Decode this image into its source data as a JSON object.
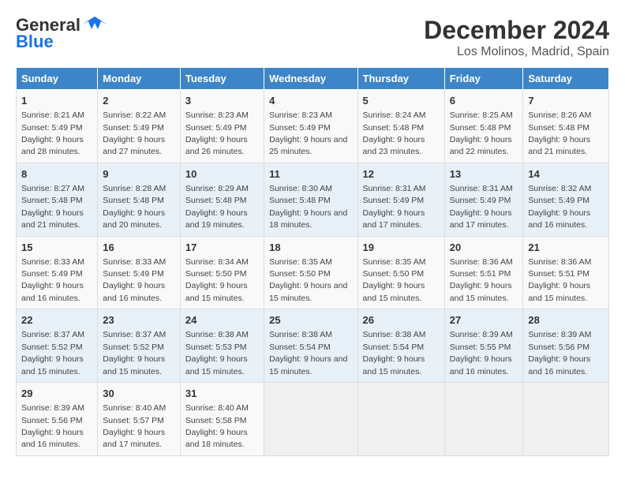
{
  "header": {
    "logo_line1": "General",
    "logo_line2": "Blue",
    "title": "December 2024",
    "subtitle": "Los Molinos, Madrid, Spain"
  },
  "days_of_week": [
    "Sunday",
    "Monday",
    "Tuesday",
    "Wednesday",
    "Thursday",
    "Friday",
    "Saturday"
  ],
  "weeks": [
    [
      {
        "day": "1",
        "sunrise": "8:21 AM",
        "sunset": "5:49 PM",
        "daylight": "9 hours and 28 minutes."
      },
      {
        "day": "2",
        "sunrise": "8:22 AM",
        "sunset": "5:49 PM",
        "daylight": "9 hours and 27 minutes."
      },
      {
        "day": "3",
        "sunrise": "8:23 AM",
        "sunset": "5:49 PM",
        "daylight": "9 hours and 26 minutes."
      },
      {
        "day": "4",
        "sunrise": "8:23 AM",
        "sunset": "5:49 PM",
        "daylight": "9 hours and 25 minutes."
      },
      {
        "day": "5",
        "sunrise": "8:24 AM",
        "sunset": "5:48 PM",
        "daylight": "9 hours and 23 minutes."
      },
      {
        "day": "6",
        "sunrise": "8:25 AM",
        "sunset": "5:48 PM",
        "daylight": "9 hours and 22 minutes."
      },
      {
        "day": "7",
        "sunrise": "8:26 AM",
        "sunset": "5:48 PM",
        "daylight": "9 hours and 21 minutes."
      }
    ],
    [
      {
        "day": "8",
        "sunrise": "8:27 AM",
        "sunset": "5:48 PM",
        "daylight": "9 hours and 21 minutes."
      },
      {
        "day": "9",
        "sunrise": "8:28 AM",
        "sunset": "5:48 PM",
        "daylight": "9 hours and 20 minutes."
      },
      {
        "day": "10",
        "sunrise": "8:29 AM",
        "sunset": "5:48 PM",
        "daylight": "9 hours and 19 minutes."
      },
      {
        "day": "11",
        "sunrise": "8:30 AM",
        "sunset": "5:48 PM",
        "daylight": "9 hours and 18 minutes."
      },
      {
        "day": "12",
        "sunrise": "8:31 AM",
        "sunset": "5:49 PM",
        "daylight": "9 hours and 17 minutes."
      },
      {
        "day": "13",
        "sunrise": "8:31 AM",
        "sunset": "5:49 PM",
        "daylight": "9 hours and 17 minutes."
      },
      {
        "day": "14",
        "sunrise": "8:32 AM",
        "sunset": "5:49 PM",
        "daylight": "9 hours and 16 minutes."
      }
    ],
    [
      {
        "day": "15",
        "sunrise": "8:33 AM",
        "sunset": "5:49 PM",
        "daylight": "9 hours and 16 minutes."
      },
      {
        "day": "16",
        "sunrise": "8:33 AM",
        "sunset": "5:49 PM",
        "daylight": "9 hours and 16 minutes."
      },
      {
        "day": "17",
        "sunrise": "8:34 AM",
        "sunset": "5:50 PM",
        "daylight": "9 hours and 15 minutes."
      },
      {
        "day": "18",
        "sunrise": "8:35 AM",
        "sunset": "5:50 PM",
        "daylight": "9 hours and 15 minutes."
      },
      {
        "day": "19",
        "sunrise": "8:35 AM",
        "sunset": "5:50 PM",
        "daylight": "9 hours and 15 minutes."
      },
      {
        "day": "20",
        "sunrise": "8:36 AM",
        "sunset": "5:51 PM",
        "daylight": "9 hours and 15 minutes."
      },
      {
        "day": "21",
        "sunrise": "8:36 AM",
        "sunset": "5:51 PM",
        "daylight": "9 hours and 15 minutes."
      }
    ],
    [
      {
        "day": "22",
        "sunrise": "8:37 AM",
        "sunset": "5:52 PM",
        "daylight": "9 hours and 15 minutes."
      },
      {
        "day": "23",
        "sunrise": "8:37 AM",
        "sunset": "5:52 PM",
        "daylight": "9 hours and 15 minutes."
      },
      {
        "day": "24",
        "sunrise": "8:38 AM",
        "sunset": "5:53 PM",
        "daylight": "9 hours and 15 minutes."
      },
      {
        "day": "25",
        "sunrise": "8:38 AM",
        "sunset": "5:54 PM",
        "daylight": "9 hours and 15 minutes."
      },
      {
        "day": "26",
        "sunrise": "8:38 AM",
        "sunset": "5:54 PM",
        "daylight": "9 hours and 15 minutes."
      },
      {
        "day": "27",
        "sunrise": "8:39 AM",
        "sunset": "5:55 PM",
        "daylight": "9 hours and 16 minutes."
      },
      {
        "day": "28",
        "sunrise": "8:39 AM",
        "sunset": "5:56 PM",
        "daylight": "9 hours and 16 minutes."
      }
    ],
    [
      {
        "day": "29",
        "sunrise": "8:39 AM",
        "sunset": "5:56 PM",
        "daylight": "9 hours and 16 minutes."
      },
      {
        "day": "30",
        "sunrise": "8:40 AM",
        "sunset": "5:57 PM",
        "daylight": "9 hours and 17 minutes."
      },
      {
        "day": "31",
        "sunrise": "8:40 AM",
        "sunset": "5:58 PM",
        "daylight": "9 hours and 18 minutes."
      },
      null,
      null,
      null,
      null
    ]
  ],
  "labels": {
    "sunrise": "Sunrise:",
    "sunset": "Sunset:",
    "daylight": "Daylight:"
  }
}
